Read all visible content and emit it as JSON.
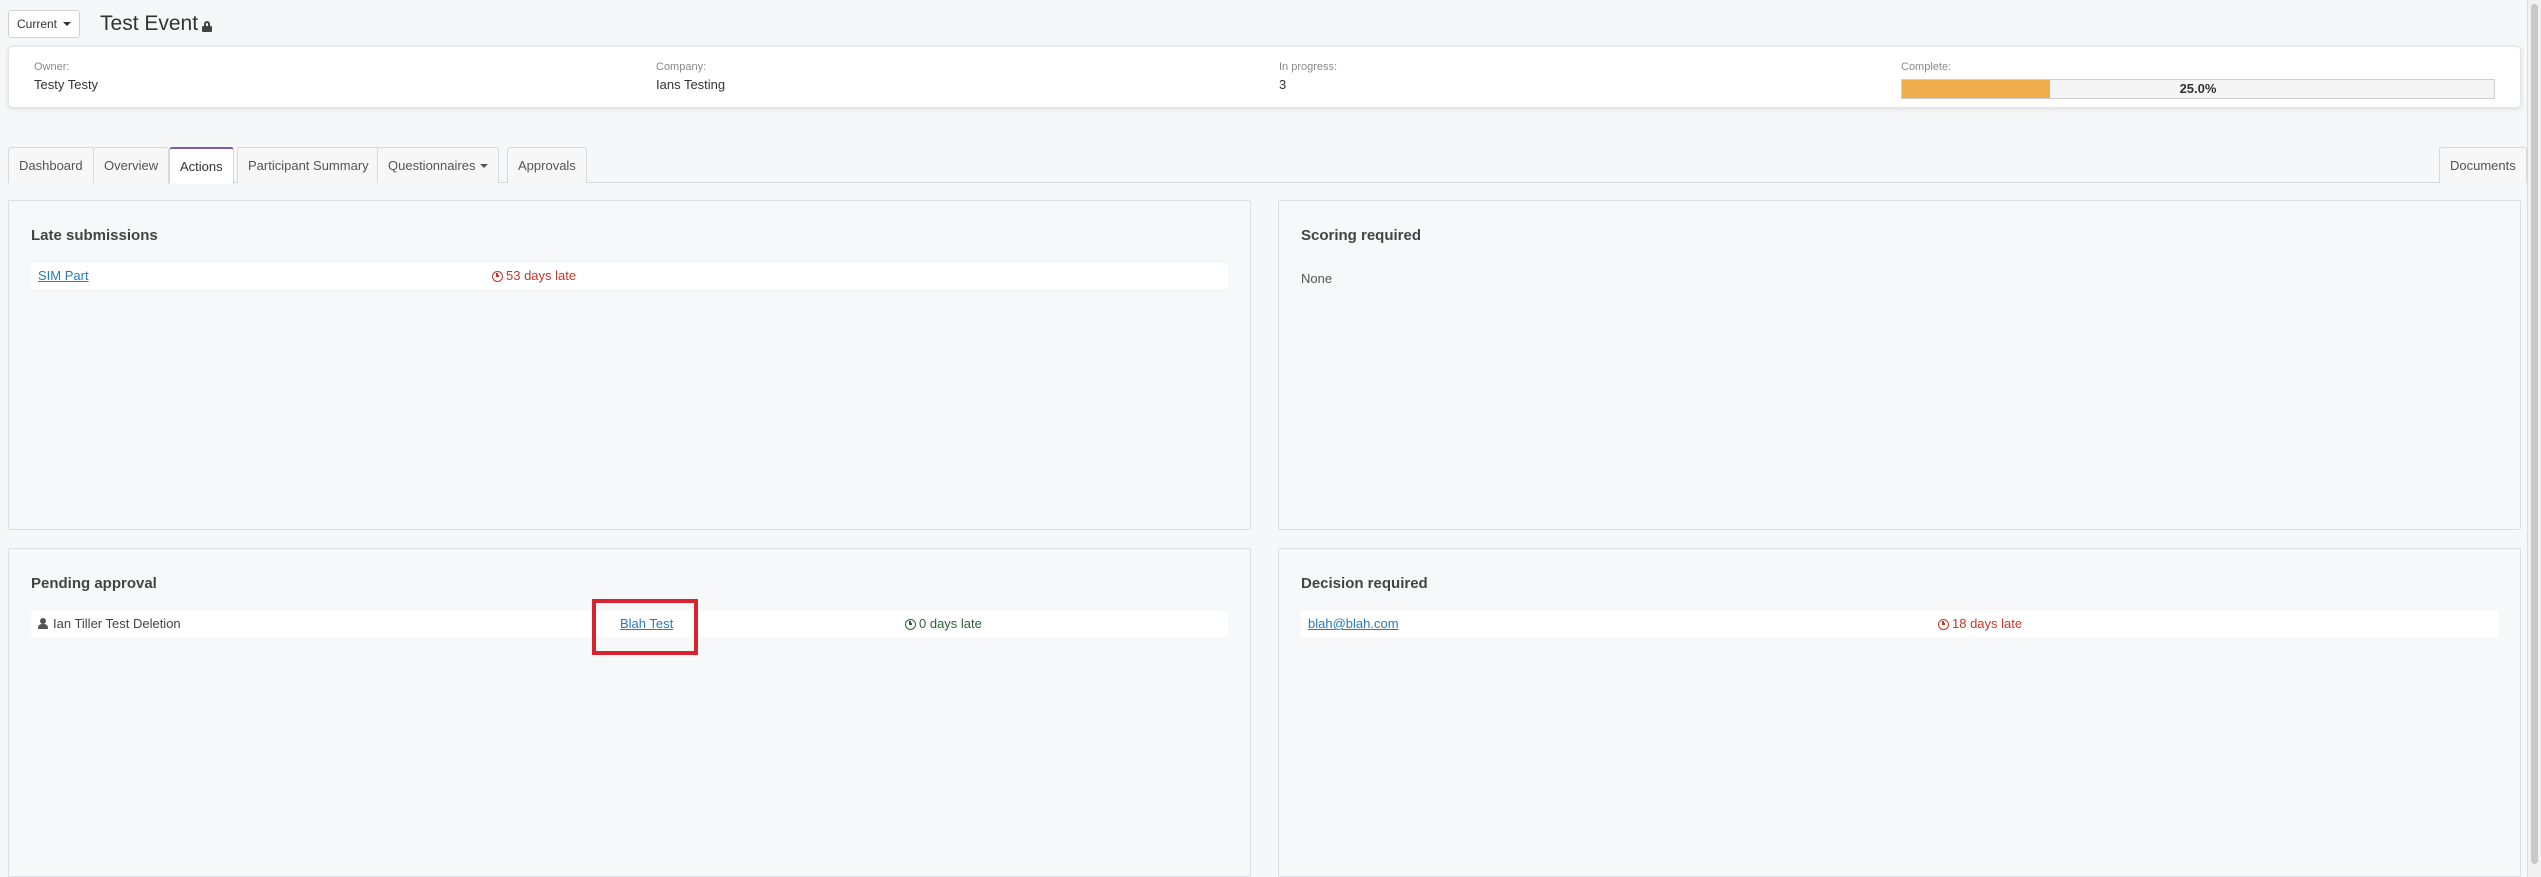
{
  "header": {
    "version_label": "Current",
    "event_title": "Test Event"
  },
  "summary": {
    "owner": {
      "label": "Owner:",
      "value": "Testy Testy"
    },
    "company": {
      "label": "Company:",
      "value": "Ians Testing"
    },
    "in_progress": {
      "label": "In progress:",
      "value": "3"
    },
    "complete": {
      "label": "Complete:",
      "percent_text": "25.0%",
      "fraction": 0.25,
      "bar_color": "#f0ad4e"
    }
  },
  "tabs": {
    "dashboard": "Dashboard",
    "overview": "Overview",
    "actions": "Actions",
    "participant_summary": "Participant Summary",
    "questionnaires": "Questionnaires",
    "approvals": "Approvals",
    "documents": "Documents",
    "active": "Actions"
  },
  "late_submissions": {
    "title": "Late submissions",
    "rows": [
      {
        "name": "SIM Part",
        "status": "53 days late"
      }
    ]
  },
  "scoring_required": {
    "title": "Scoring required",
    "empty_text": "None"
  },
  "pending_approval": {
    "title": "Pending approval",
    "rows": [
      {
        "user": "Ian Tiller Test Deletion",
        "name": "Blah Test",
        "status": "0 days late"
      }
    ]
  },
  "decision_required": {
    "title": "Decision required",
    "rows": [
      {
        "email": "blah@blah.com",
        "status": "18 days late"
      }
    ]
  },
  "colors": {
    "accent_tab": "#7c5aa6",
    "late": "#c0392b",
    "ontime": "#2f5f3a",
    "link": "#2a7ab8",
    "highlight": "#d9232e"
  }
}
